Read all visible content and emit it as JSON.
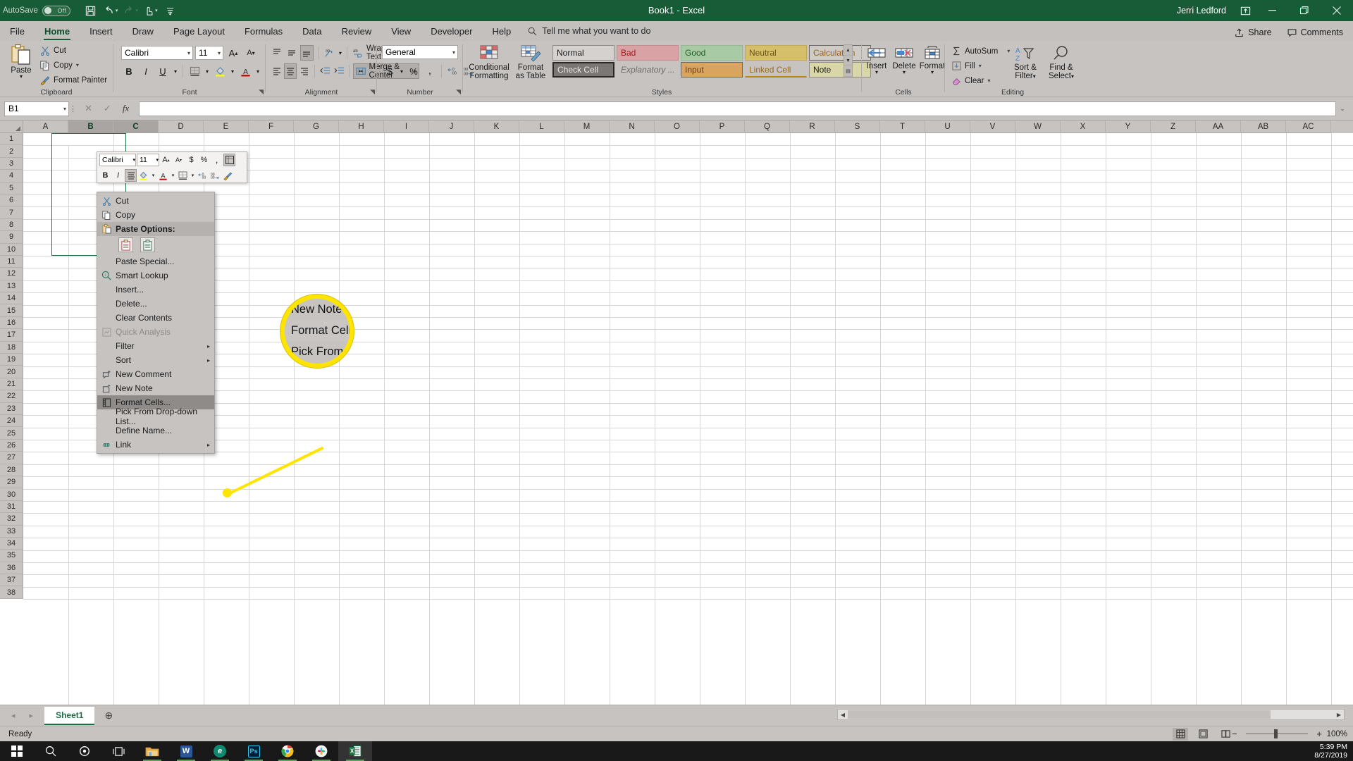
{
  "titlebar": {
    "autosave_label": "AutoSave",
    "autosave_state": "Off",
    "quick_access": [
      {
        "name": "save-button",
        "glyph": "ὋE"
      },
      {
        "name": "undo-button",
        "glyph": "↶"
      },
      {
        "name": "redo-button",
        "glyph": "↷"
      },
      {
        "name": "touch-mode-button",
        "glyph": "☚"
      },
      {
        "name": "customize-qat-button",
        "glyph": "≡"
      }
    ],
    "document_title": "Book1  -  Excel",
    "account_name": "Jerri Ledford",
    "ribbon_display_options": "⬚",
    "minimize": "—",
    "restore": "❐",
    "close": "✕"
  },
  "tabs": [
    {
      "label": "File",
      "active": false
    },
    {
      "label": "Home",
      "active": true
    },
    {
      "label": "Insert",
      "active": false
    },
    {
      "label": "Draw",
      "active": false
    },
    {
      "label": "Page Layout",
      "active": false
    },
    {
      "label": "Formulas",
      "active": false
    },
    {
      "label": "Data",
      "active": false
    },
    {
      "label": "Review",
      "active": false
    },
    {
      "label": "View",
      "active": false
    },
    {
      "label": "Developer",
      "active": false
    },
    {
      "label": "Help",
      "active": false
    }
  ],
  "tellme": {
    "label": "Tell me what you want to do"
  },
  "tabbar_right": {
    "share": "Share",
    "comments": "Comments"
  },
  "ribbon": {
    "groups": [
      {
        "name": "clipboard",
        "label": "Clipboard"
      },
      {
        "name": "font",
        "label": "Font"
      },
      {
        "name": "alignment",
        "label": "Alignment"
      },
      {
        "name": "number",
        "label": "Number"
      },
      {
        "name": "styles",
        "label": "Styles"
      },
      {
        "name": "cells",
        "label": "Cells"
      },
      {
        "name": "editing",
        "label": "Editing"
      }
    ],
    "clipboard": {
      "paste": "Paste",
      "cut": "Cut",
      "copy": "Copy",
      "format_painter": "Format Painter"
    },
    "font": {
      "font_name": "Calibri",
      "font_size": "11",
      "grow_font": "A",
      "shrink_font": "A",
      "bold": "B",
      "italic": "I",
      "underline": "U",
      "borders": "▦",
      "fill_color": "A",
      "font_color": "A"
    },
    "alignment": {
      "wrap_text": "Wrap Text",
      "merge_center": "Merge & Center",
      "orientation": "↗"
    },
    "number": {
      "format": "General",
      "accounting": "$",
      "percent": "%",
      "comma": ",",
      "increase_decimal": "←.00",
      "decrease_decimal": ".00→"
    },
    "styles": {
      "conditional_formatting": "Conditional Formatting",
      "format_as_table": "Format as Table",
      "cell_styles": [
        {
          "label": "Normal",
          "bg": "#d4d1ce",
          "fg": "#1a1a1a",
          "border": "#8e8b88"
        },
        {
          "label": "Bad",
          "bg": "#d9a3a5",
          "fg": "#9c1a1a",
          "border": "#c08c8e"
        },
        {
          "label": "Good",
          "bg": "#a8cba6",
          "fg": "#1d5e22",
          "border": "#95b893"
        },
        {
          "label": "Neutral",
          "bg": "#d6bf6a",
          "fg": "#6b5413",
          "border": "#c0aa58"
        },
        {
          "label": "Calculation",
          "bg": "#cfccc7",
          "fg": "#9b5d17",
          "border": "#6b6865"
        },
        {
          "label": "Check Cell",
          "bg": "#7a7774",
          "fg": "#e9e7e5",
          "border": "#2b2825"
        },
        {
          "label": "Explanatory ...",
          "bg": "#c6c3c0",
          "fg": "#6f6c69",
          "border": "#c6c3c0"
        },
        {
          "label": "Input",
          "bg": "#d9a460",
          "fg": "#6b3a10",
          "border": "#6b6865"
        },
        {
          "label": "Linked Cell",
          "bg": "#c6c3c0",
          "fg": "#9b6b17",
          "border": "#c6c3c0"
        },
        {
          "label": "Note",
          "bg": "#d9d6a8",
          "fg": "#1a1a1a",
          "border": "#8e8b88"
        }
      ]
    },
    "cells": {
      "insert": "Insert",
      "delete": "Delete",
      "format": "Format"
    },
    "editing": {
      "autosum": "AutoSum",
      "fill": "Fill",
      "clear": "Clear",
      "sort_filter_l1": "Sort &",
      "sort_filter_l2": "Filter",
      "find_select_l1": "Find &",
      "find_select_l2": "Select"
    }
  },
  "formula_bar": {
    "name_box": "B1",
    "cancel": "✕",
    "enter": "✓",
    "insert_function": "fx",
    "formula_value": "",
    "expand": "⌄"
  },
  "grid": {
    "columns": [
      "A",
      "B",
      "C",
      "D",
      "E",
      "F",
      "G",
      "H",
      "I",
      "J",
      "K",
      "L",
      "M",
      "N",
      "O",
      "P",
      "Q",
      "R",
      "S",
      "T",
      "U",
      "V",
      "W",
      "X",
      "Y",
      "Z",
      "AA",
      "AB",
      "AC"
    ],
    "selected_columns": [
      "B",
      "C"
    ],
    "rows": [
      1,
      2,
      3,
      4,
      5,
      6,
      7,
      8,
      9,
      10,
      11,
      12,
      13,
      14,
      15,
      16,
      17,
      18,
      19,
      20,
      21,
      22,
      23,
      24,
      25,
      26,
      27,
      28,
      29,
      30,
      31,
      32,
      33,
      34,
      35,
      36,
      37,
      38
    ],
    "selection_range": "B1:C10",
    "active_cell": "B1"
  },
  "mini_toolbar": {
    "font_name": "Calibri",
    "font_size": "11",
    "grow_font": "A",
    "shrink_font": "A",
    "accounting": "$",
    "percent": "%",
    "comma": ",",
    "format_cells": "▦",
    "bold": "B",
    "italic": "I",
    "align": "≡",
    "fill_color": "▲",
    "font_color": "A",
    "borders": "▦",
    "increase_decimal": "←.0",
    "decrease_decimal": ".0→",
    "format_painter": "✎"
  },
  "context_menu": {
    "items": [
      {
        "label": "Cut",
        "icon": "scissors-icon",
        "type": "item",
        "underline_at": 2
      },
      {
        "label": "Copy",
        "icon": "copy-icon",
        "type": "item",
        "underline_at": 0
      },
      {
        "label": "Paste Options:",
        "icon": "paste-icon",
        "type": "header"
      },
      {
        "label": "",
        "icon": "",
        "type": "paste-gallery"
      },
      {
        "label": "Paste Special...",
        "icon": "",
        "type": "item",
        "underline_at": 6
      },
      {
        "label": "Smart Lookup",
        "icon": "smart-lookup-icon",
        "type": "item",
        "underline_at": 6
      },
      {
        "label": "Insert...",
        "icon": "",
        "type": "item",
        "underline_at": 0
      },
      {
        "label": "Delete...",
        "icon": "",
        "type": "item",
        "underline_at": 0
      },
      {
        "label": "Clear Contents",
        "icon": "",
        "type": "item",
        "underline_at": 9
      },
      {
        "label": "Quick Analysis",
        "icon": "quick-analysis-icon",
        "type": "disabled"
      },
      {
        "label": "Filter",
        "icon": "",
        "type": "submenu",
        "underline_at": 4
      },
      {
        "label": "Sort",
        "icon": "",
        "type": "submenu",
        "underline_at": 1
      },
      {
        "label": "New Comment",
        "icon": "comment-icon",
        "type": "item",
        "underline_at": 6
      },
      {
        "label": "New Note",
        "icon": "note-icon",
        "type": "item",
        "underline_at": 0
      },
      {
        "label": "Format Cells...",
        "icon": "format-cells-icon",
        "type": "selected",
        "underline_at": 0
      },
      {
        "label": "Pick From Drop-down List...",
        "icon": "",
        "type": "item",
        "underline_at": 3
      },
      {
        "label": "Define Name...",
        "icon": "",
        "type": "item",
        "underline_at": 8
      },
      {
        "label": "Link",
        "icon": "link-icon",
        "type": "submenu",
        "underline_at": 0
      }
    ],
    "submenu_arrow": "▸"
  },
  "callout": {
    "highlight_color": "#ffe400",
    "items": [
      {
        "label": "New Note",
        "selected": false
      },
      {
        "label": "Format Cells...",
        "selected": true
      },
      {
        "label": "Pick From Dr",
        "selected": false
      }
    ]
  },
  "sheet_bar": {
    "prev": "◂",
    "next": "▸",
    "tabs": [
      {
        "label": "Sheet1",
        "active": true
      }
    ],
    "add_sheet": "⊕"
  },
  "status_bar": {
    "status": "Ready",
    "views": [
      {
        "name": "normal-view-button",
        "glyph": "▦",
        "active": true
      },
      {
        "name": "page-layout-view-button",
        "glyph": "▤",
        "active": false
      },
      {
        "name": "page-break-view-button",
        "glyph": "▥",
        "active": false
      }
    ],
    "zoom_out": "−",
    "zoom_in": "+",
    "zoom_level": "100%"
  },
  "taskbar": {
    "items": [
      {
        "name": "start-button",
        "glyph": "⊞",
        "kind": "start"
      },
      {
        "name": "search-icon",
        "glyph": "⚲",
        "kind": "glyph"
      },
      {
        "name": "cortana-icon",
        "glyph": "○",
        "kind": "glyph"
      },
      {
        "name": "task-view-icon",
        "glyph": "⌸",
        "kind": "glyph"
      },
      {
        "name": "file-explorer-icon",
        "glyph": "",
        "kind": "explorer"
      },
      {
        "name": "word-icon",
        "glyph": "W",
        "kind": "square",
        "color": "#2b579a"
      },
      {
        "name": "edge-icon",
        "glyph": "e",
        "kind": "circle",
        "color": "#0f8a6e"
      },
      {
        "name": "photoshop-icon",
        "glyph": "Ps",
        "kind": "square",
        "color": "#001e36"
      },
      {
        "name": "chrome-icon",
        "glyph": "",
        "kind": "chrome"
      },
      {
        "name": "slack-icon",
        "glyph": "",
        "kind": "slack"
      },
      {
        "name": "excel-icon",
        "glyph": "X",
        "kind": "excel",
        "color": "#1d6f42"
      }
    ],
    "clock_time": "5:39 PM",
    "clock_date": "8/27/2019"
  }
}
